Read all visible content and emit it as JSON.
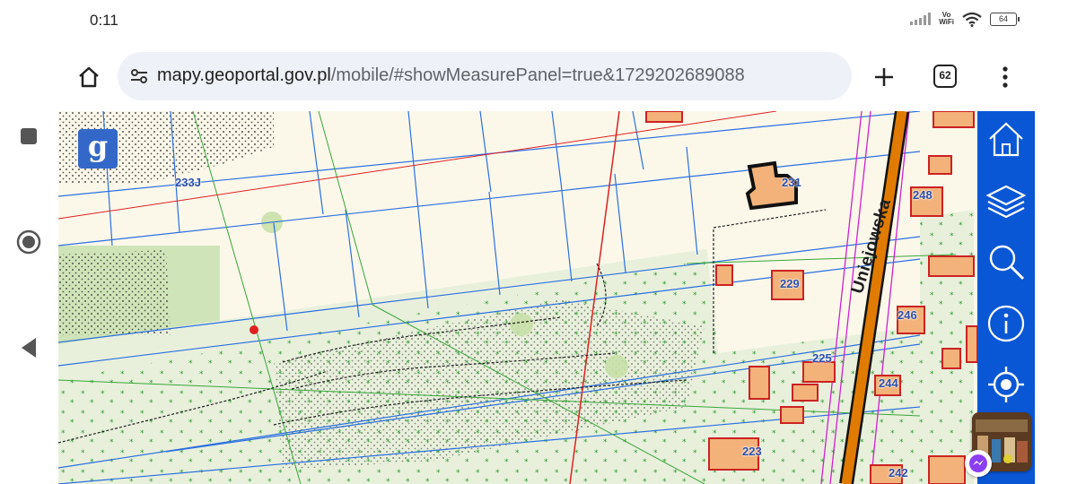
{
  "status_bar": {
    "time": "0:11",
    "vowifi_top": "Vo",
    "vowifi_bottom": "WiFi",
    "battery_level": "64",
    "icons": [
      "signal-icon",
      "wifi-icon",
      "battery-icon"
    ]
  },
  "nav_bar": {
    "buttons": [
      "recents-button",
      "home-button",
      "back-button"
    ]
  },
  "browser": {
    "url_host": "mapy.geoportal.gov.pl",
    "url_path": "/mobile/#showMeasurePanel=true&1729202689088",
    "tab_count": "62",
    "icons": [
      "home-icon",
      "site-settings-icon",
      "plus-icon",
      "tabs-icon",
      "more-vert-icon"
    ]
  },
  "map": {
    "logo_letter": "g",
    "street_name": "Uniejowska",
    "parcels": [
      "233J",
      "231",
      "248",
      "229",
      "246",
      "225",
      "244",
      "223",
      "242"
    ],
    "colors": {
      "background": "#fbf8ea",
      "building_fill": "#f3b27a",
      "building_outline": "#cc2222",
      "parcel_line": "#2b6fe0",
      "road": "#e07b00",
      "forest": "#cfe4b8",
      "toolbar": "#0a57d6"
    }
  },
  "toolbar": {
    "buttons": [
      "home-map-button",
      "layers-button",
      "search-button",
      "info-button",
      "locate-button"
    ]
  }
}
